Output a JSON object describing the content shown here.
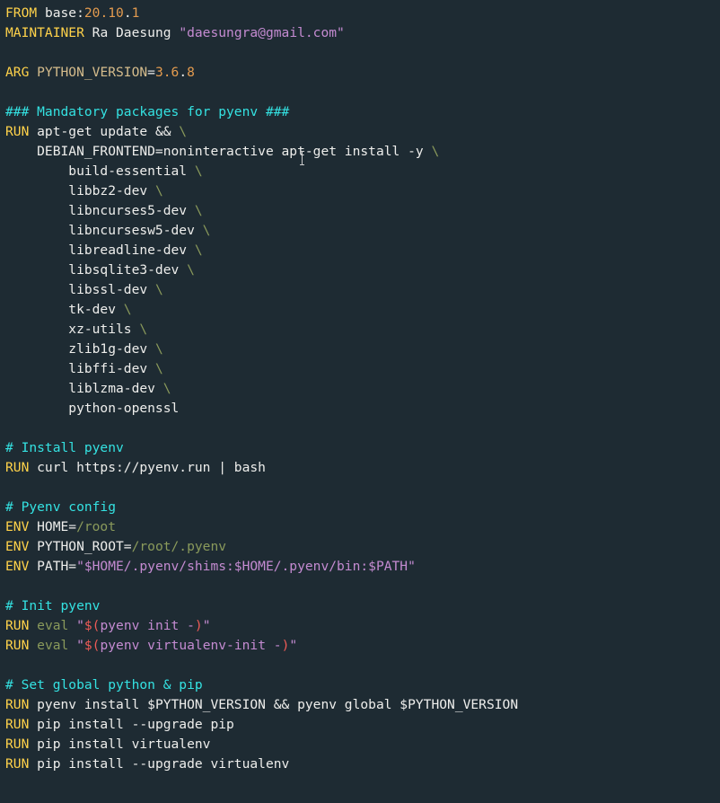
{
  "colors": {
    "background": "#1e2b33",
    "keyword": "#ffd24a",
    "comment": "#34e2e2",
    "default": "#eeeeec",
    "olive": "#8a9a5b",
    "string": "#c48bd1",
    "number": "#e39b4f",
    "variable": "#d5bc8c",
    "command_sub": "#ef5b56"
  },
  "lines": [
    [
      [
        "kw",
        "FROM"
      ],
      [
        "white",
        " base:"
      ],
      [
        "orange",
        "20.10"
      ],
      [
        "white",
        "."
      ],
      [
        "orange",
        "1"
      ]
    ],
    [
      [
        "kw",
        "MAINTAINER"
      ],
      [
        "white",
        " Ra Daesung "
      ],
      [
        "mauve",
        "\"daesungra@gmail.com\""
      ]
    ],
    [
      [
        "white",
        ""
      ]
    ],
    [
      [
        "kw",
        "ARG"
      ],
      [
        "white",
        " "
      ],
      [
        "pale",
        "PYTHON_VERSION"
      ],
      [
        "white",
        "="
      ],
      [
        "orange",
        "3.6"
      ],
      [
        "white",
        "."
      ],
      [
        "orange",
        "8"
      ]
    ],
    [
      [
        "white",
        ""
      ]
    ],
    [
      [
        "cyan",
        "### Mandatory packages for pyenv ###"
      ]
    ],
    [
      [
        "kw",
        "RUN"
      ],
      [
        "white",
        " apt-get update && "
      ],
      [
        "olive",
        "\\"
      ]
    ],
    [
      [
        "white",
        "    DEBIAN_FRONTEND=noninteractive apt-get install -y "
      ],
      [
        "olive",
        "\\"
      ]
    ],
    [
      [
        "white",
        "        build-essential "
      ],
      [
        "olive",
        "\\"
      ]
    ],
    [
      [
        "white",
        "        libbz2-dev "
      ],
      [
        "olive",
        "\\"
      ]
    ],
    [
      [
        "white",
        "        libncurses5-dev "
      ],
      [
        "olive",
        "\\"
      ]
    ],
    [
      [
        "white",
        "        libncursesw5-dev "
      ],
      [
        "olive",
        "\\"
      ]
    ],
    [
      [
        "white",
        "        libreadline-dev "
      ],
      [
        "olive",
        "\\"
      ]
    ],
    [
      [
        "white",
        "        libsqlite3-dev "
      ],
      [
        "olive",
        "\\"
      ]
    ],
    [
      [
        "white",
        "        libssl-dev "
      ],
      [
        "olive",
        "\\"
      ]
    ],
    [
      [
        "white",
        "        tk-dev "
      ],
      [
        "olive",
        "\\"
      ]
    ],
    [
      [
        "white",
        "        xz-utils "
      ],
      [
        "olive",
        "\\"
      ]
    ],
    [
      [
        "white",
        "        zlib1g-dev "
      ],
      [
        "olive",
        "\\"
      ]
    ],
    [
      [
        "white",
        "        libffi-dev "
      ],
      [
        "olive",
        "\\"
      ]
    ],
    [
      [
        "white",
        "        liblzma-dev "
      ],
      [
        "olive",
        "\\"
      ]
    ],
    [
      [
        "white",
        "        python-openssl"
      ]
    ],
    [
      [
        "white",
        ""
      ]
    ],
    [
      [
        "cyan",
        "# Install pyenv"
      ]
    ],
    [
      [
        "kw",
        "RUN"
      ],
      [
        "white",
        " curl https://pyenv.run | bash"
      ]
    ],
    [
      [
        "white",
        ""
      ]
    ],
    [
      [
        "cyan",
        "# Pyenv config"
      ]
    ],
    [
      [
        "kw",
        "ENV"
      ],
      [
        "white",
        " HOME="
      ],
      [
        "olive",
        "/root"
      ]
    ],
    [
      [
        "kw",
        "ENV"
      ],
      [
        "white",
        " PYTHON_ROOT="
      ],
      [
        "olive",
        "/root/.pyenv"
      ]
    ],
    [
      [
        "kw",
        "ENV"
      ],
      [
        "white",
        " PATH="
      ],
      [
        "mauve",
        "\"$HOME/.pyenv/shims:$HOME/.pyenv/bin:$PATH\""
      ]
    ],
    [
      [
        "white",
        ""
      ]
    ],
    [
      [
        "cyan",
        "# Init pyenv"
      ]
    ],
    [
      [
        "kw",
        "RUN"
      ],
      [
        "white",
        " "
      ],
      [
        "olive",
        "eval "
      ],
      [
        "mauve",
        "\""
      ],
      [
        "red",
        "$("
      ],
      [
        "mauve",
        "pyenv init -"
      ],
      [
        "red",
        ")"
      ],
      [
        "mauve",
        "\""
      ]
    ],
    [
      [
        "kw",
        "RUN"
      ],
      [
        "white",
        " "
      ],
      [
        "olive",
        "eval "
      ],
      [
        "mauve",
        "\""
      ],
      [
        "red",
        "$("
      ],
      [
        "mauve",
        "pyenv virtualenv-init -"
      ],
      [
        "red",
        ")"
      ],
      [
        "mauve",
        "\""
      ]
    ],
    [
      [
        "white",
        ""
      ]
    ],
    [
      [
        "cyan",
        "# Set global python & pip"
      ]
    ],
    [
      [
        "kw",
        "RUN"
      ],
      [
        "white",
        " pyenv install $PYTHON_VERSION && pyenv global $PYTHON_VERSION"
      ]
    ],
    [
      [
        "kw",
        "RUN"
      ],
      [
        "white",
        " pip install --upgrade pip"
      ]
    ],
    [
      [
        "kw",
        "RUN"
      ],
      [
        "white",
        " pip install virtualenv"
      ]
    ],
    [
      [
        "kw",
        "RUN"
      ],
      [
        "white",
        " pip install --upgrade virtualenv"
      ]
    ]
  ]
}
